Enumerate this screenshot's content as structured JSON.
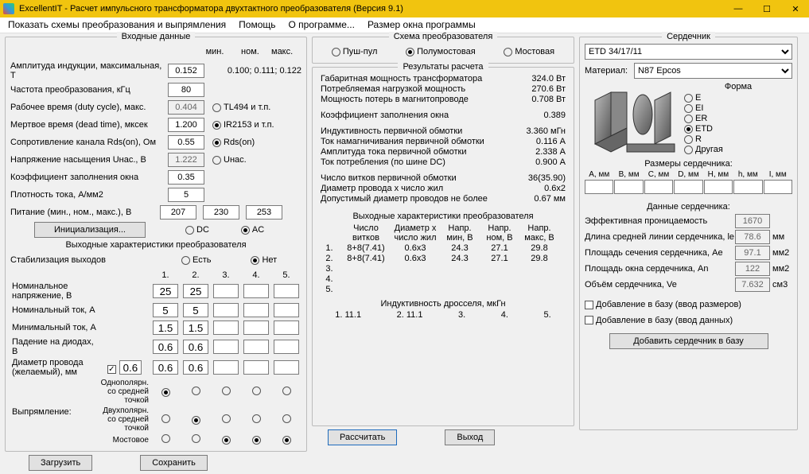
{
  "window": {
    "title": "ExcellentIT - Расчет импульсного трансформатора двухтактного преобразователя (Версия 9.1)"
  },
  "menu": {
    "schemes": "Показать схемы преобразования и выпрямления",
    "help": "Помощь",
    "about": "О программе...",
    "winsize": "Размер окна программы"
  },
  "input": {
    "title": "Входные данные",
    "hdr_min": "мин.",
    "hdr_nom": "ном.",
    "hdr_max": "макс.",
    "r_amp": {
      "label": "Амплитуда индукции, максимальная, Т",
      "val": "0.152",
      "hint": "0.100; 0.111; 0.122"
    },
    "r_freq": {
      "label": "Частота преобразования, кГц",
      "val": "80"
    },
    "r_duty": {
      "label": "Рабочее время (duty cycle), макс.",
      "val": "0.404",
      "opt": "TL494 и т.п."
    },
    "r_dead": {
      "label": "Мертвое время (dead time), мксек",
      "val": "1.200",
      "opt": "IR2153 и т.п."
    },
    "r_rds": {
      "label": "Сопротивление канала Rds(on), Ом",
      "val": "0.55",
      "opt": "Rds(on)"
    },
    "r_usat": {
      "label": "Напряжение насыщения Uнас., В",
      "val": "1.222",
      "opt": "Uнас."
    },
    "r_kfill": {
      "label": "Коэффициент заполнения окна",
      "val": "0.35"
    },
    "r_jdens": {
      "label": "Плотность тока, А/мм2",
      "val": "5"
    },
    "r_power": {
      "label": "Питание (мин., ном., макс.), В",
      "v1": "207",
      "v2": "230",
      "v3": "253"
    },
    "init_btn": "Инициализация...",
    "dc": "DC",
    "ac": "AC",
    "out_title": "Выходные характеристики преобразователя",
    "stab_label": "Стабилизация выходов",
    "stab_yes": "Есть",
    "stab_no": "Нет",
    "cols": [
      "1.",
      "2.",
      "3.",
      "4.",
      "5."
    ],
    "rows": {
      "vnom": {
        "label": "Номинальное напряжение, В",
        "v": [
          "25",
          "25",
          "",
          "",
          ""
        ]
      },
      "inom": {
        "label": "Номинальный ток, А",
        "v": [
          "5",
          "5",
          "",
          "",
          ""
        ]
      },
      "imin": {
        "label": "Минимальный ток, А",
        "v": [
          "1.5",
          "1.5",
          "",
          "",
          ""
        ]
      },
      "diod": {
        "label": "Падение на диодах, В",
        "v": [
          "0.6",
          "0.6",
          "",
          "",
          ""
        ]
      },
      "wire": {
        "label": "Диаметр провода (желаемый), мм",
        "chk": true,
        "base": "0.6",
        "v": [
          "0.6",
          "0.6",
          "",
          "",
          ""
        ]
      }
    },
    "rect_label": "Выпрямление:",
    "rect_rows": {
      "r1": "Однополярн. со средней точкой",
      "r2": "Двухполярн. со средней точкой",
      "r3": "Мостовое"
    },
    "load_btn": "Загрузить",
    "save_btn": "Сохранить"
  },
  "scheme": {
    "title": "Схема преобразователя",
    "pp": "Пуш-пул",
    "hb": "Полумостовая",
    "fb": "Мостовая"
  },
  "results": {
    "title": "Результаты расчета",
    "lines": [
      {
        "l": "Габаритная мощность трансформатора",
        "v": "324.0 Вт"
      },
      {
        "l": "Потребляемая нагрузкой мощность",
        "v": "270.6 Вт"
      },
      {
        "l": "Мощность потерь в магнитопроводе",
        "v": "0.708 Вт"
      },
      {
        "l": "Коэффициент заполнения окна",
        "v": "0.389"
      },
      {
        "l": "Индуктивность первичной обмотки",
        "v": "3.360 мГн"
      },
      {
        "l": "Ток намагничивания первичной обмотки",
        "v": "0.116 А"
      },
      {
        "l": "Амплитуда тока первичной обмотки",
        "v": "2.338 А"
      },
      {
        "l": "Ток потребления (по шине DC)",
        "v": "0.900 А"
      },
      {
        "l": "Число витков первичной обмотки",
        "v": "36(35.90)"
      },
      {
        "l": "Диаметр провода х число жил",
        "v": "0.6x2"
      },
      {
        "l": "Допустимый диаметр проводов не более",
        "v": "0.67 мм"
      }
    ],
    "out_title": "Выходные характеристики преобразователя",
    "out_hdr": [
      "",
      "Число витков",
      "Диаметр х число жил",
      "Напр. мин, В",
      "Напр. ном, В",
      "Напр. макс, В"
    ],
    "out_rows": [
      [
        "1.",
        "8+8(7.41)",
        "0.6x3",
        "24.3",
        "27.1",
        "29.8"
      ],
      [
        "2.",
        "8+8(7.41)",
        "0.6x3",
        "24.3",
        "27.1",
        "29.8"
      ],
      [
        "3.",
        "",
        "",
        "",
        "",
        ""
      ],
      [
        "4.",
        "",
        "",
        "",
        "",
        ""
      ],
      [
        "5.",
        "",
        "",
        "",
        "",
        ""
      ]
    ],
    "ind_title": "Индуктивность дросселя, мкГн",
    "ind_row": [
      "1. 11.1",
      "2. 11.1",
      "3.",
      "4.",
      "5."
    ],
    "calc_btn": "Рассчитать",
    "exit_btn": "Выход"
  },
  "core": {
    "title": "Сердечник",
    "name": "ETD 34/17/11",
    "mat_label": "Материал:",
    "mat": "N87 Epcos",
    "form_label": "Форма",
    "forms": [
      "E",
      "EI",
      "ER",
      "ETD",
      "R",
      "Другая"
    ],
    "form_sel": "ETD",
    "dim_title": "Размеры сердечника:",
    "dim_hdr": [
      "A, мм",
      "B, мм",
      "C, мм",
      "D, мм",
      "H, мм",
      "h, мм",
      "I, мм"
    ],
    "data_title": "Данные сердечника:",
    "data": [
      {
        "l": "Эффективная проницаемость",
        "v": "1670",
        "u": ""
      },
      {
        "l": "Длина средней линии сердечника, le",
        "v": "78.6",
        "u": "мм"
      },
      {
        "l": "Площадь сечения сердечника, Ae",
        "v": "97.1",
        "u": "мм2"
      },
      {
        "l": "Площадь окна сердечника, An",
        "v": "122",
        "u": "мм2"
      },
      {
        "l": "Объём сердечника, Ve",
        "v": "7.632",
        "u": "см3"
      }
    ],
    "add_dim": "Добавление в базу (ввод размеров)",
    "add_dat": "Добавление в базу (ввод данных)",
    "add_btn": "Добавить сердечник в базу"
  }
}
